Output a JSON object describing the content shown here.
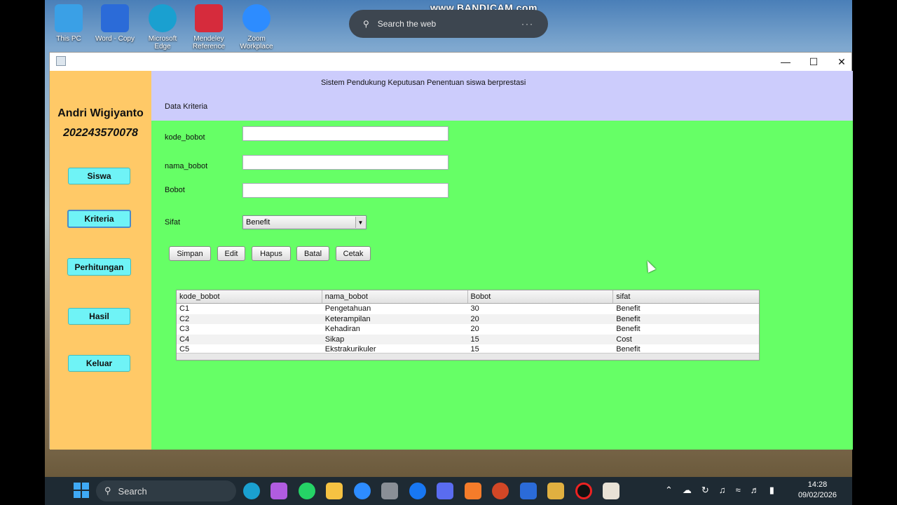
{
  "desktop": {
    "icons": [
      {
        "label": "This PC",
        "color": "#3aa0e6"
      },
      {
        "label": "Word - Copy",
        "color": "#2b6bd8"
      },
      {
        "label": "Microsoft Edge",
        "color": "#1aa0d0"
      },
      {
        "label": "Mendeley Reference",
        "color": "#d62b3c"
      },
      {
        "label": "Zoom Workplace",
        "color": "#2d8cff"
      }
    ],
    "watermark": "www.BANDICAM.com",
    "web_search_placeholder": "Search the web",
    "web_search_more": "···"
  },
  "window": {
    "controls": {
      "minimize": "—",
      "maximize": "☐",
      "close": "✕"
    },
    "sidebar": {
      "name": "Andri Wigiyanto",
      "nim": "202243570078",
      "nav": [
        "Siswa",
        "Kriteria",
        "Perhitungan",
        "Hasil",
        "Keluar"
      ],
      "active": "Kriteria"
    },
    "header": {
      "app_title": "Sistem Pendukung Keputusan Penentuan siswa berprestasi",
      "section_title": "Data Kriteria"
    },
    "form": {
      "kode_label": "kode_bobot",
      "kode_value": "",
      "nama_label": "nama_bobot",
      "nama_value": "",
      "bobot_label": "Bobot",
      "bobot_value": "",
      "sifat_label": "Sifat",
      "sifat_selected": "Benefit"
    },
    "actions": [
      "Simpan",
      "Edit",
      "Hapus",
      "Batal",
      "Cetak"
    ],
    "table": {
      "columns": [
        "kode_bobot",
        "nama_bobot",
        "Bobot",
        "sifat"
      ],
      "rows": [
        [
          "C1",
          "Pengetahuan",
          "30",
          "Benefit"
        ],
        [
          "C2",
          "Keterampilan",
          "20",
          "Benefit"
        ],
        [
          "C3",
          "Kehadiran",
          "20",
          "Benefit"
        ],
        [
          "C4",
          "Sikap",
          "15",
          "Cost"
        ],
        [
          "C5",
          "Ekstrakurikuler",
          "15",
          "Benefit"
        ]
      ]
    }
  },
  "taskbar": {
    "search_placeholder": "Search",
    "time": "14:28",
    "date": "09/02/2026"
  }
}
